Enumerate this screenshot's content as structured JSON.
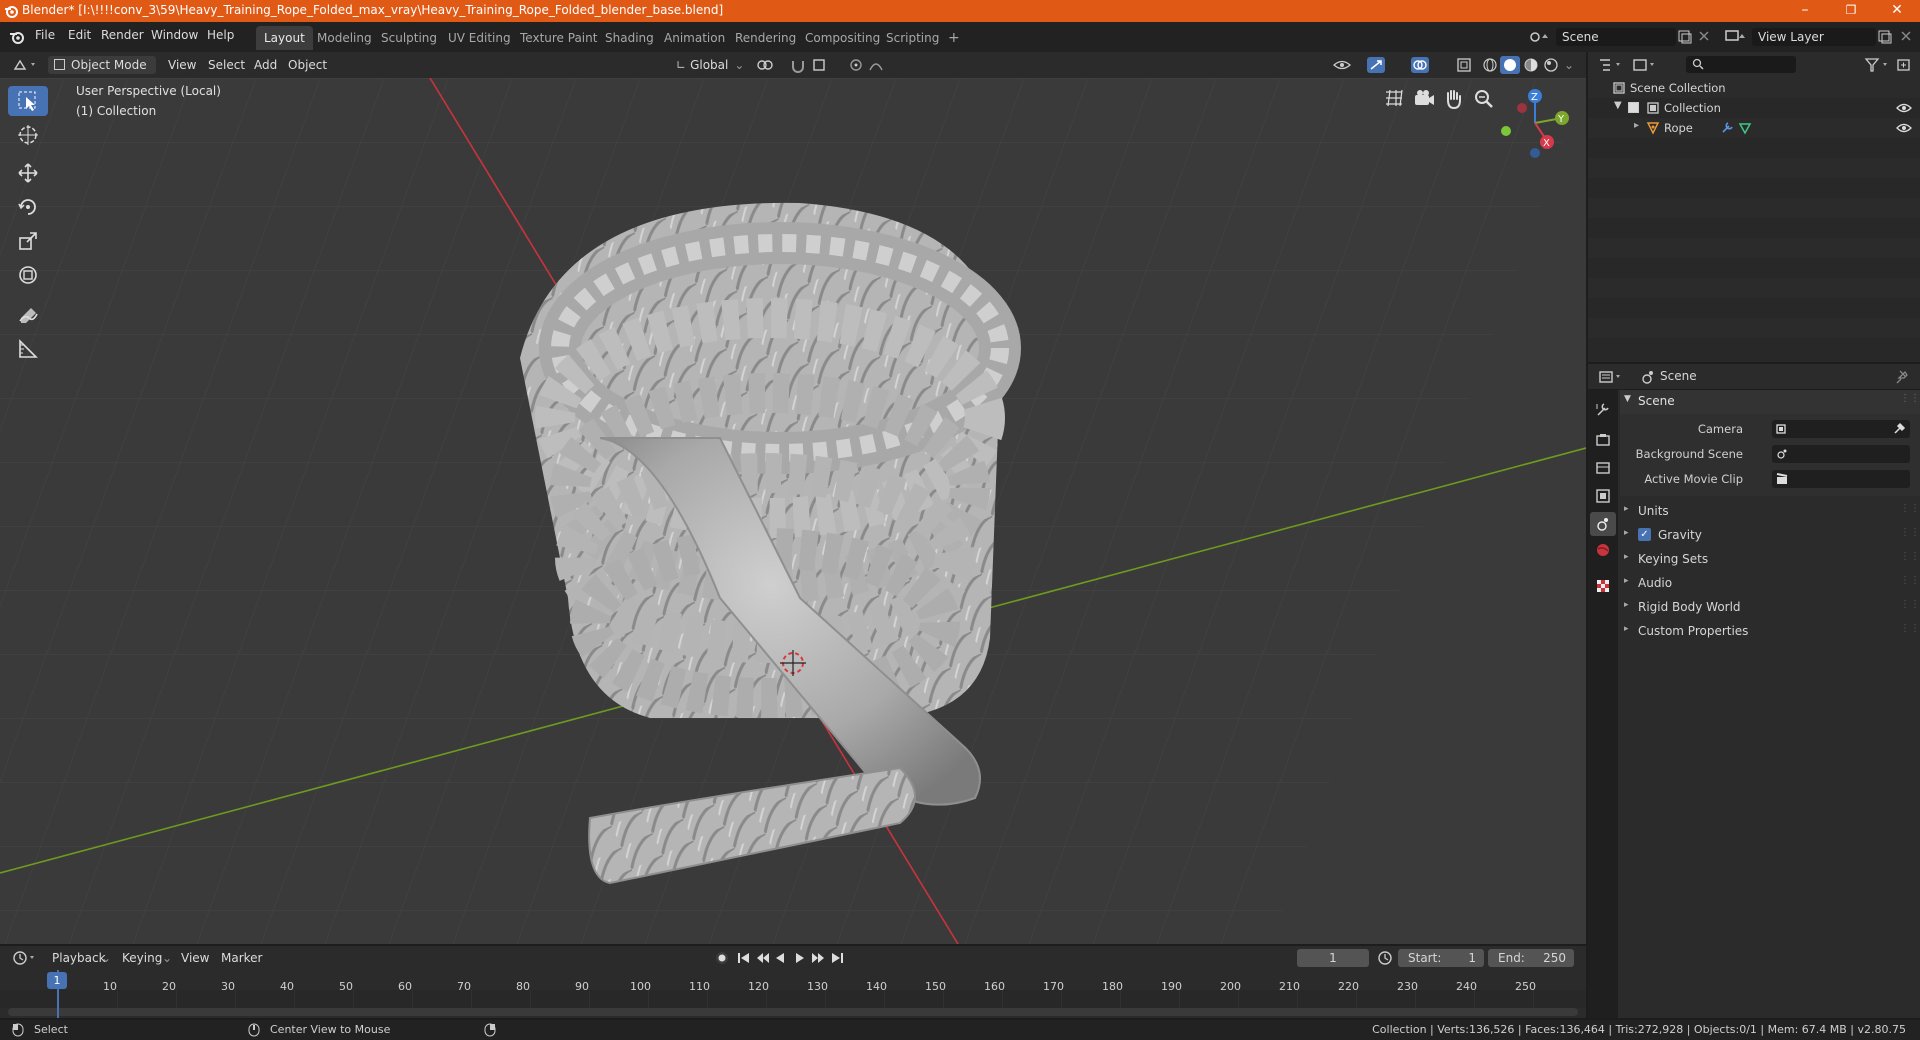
{
  "titlebar": {
    "title": "Blender* [I:\\!!!!conv_3\\59\\Heavy_Training_Rope_Folded_max_vray\\Heavy_Training_Rope_Folded_blender_base.blend]",
    "minimize": "–",
    "restore": "❐",
    "close": "✕"
  },
  "menu": [
    "File",
    "Edit",
    "Render",
    "Window",
    "Help"
  ],
  "workspaces": [
    "Layout",
    "Modeling",
    "Sculpting",
    "UV Editing",
    "Texture Paint",
    "Shading",
    "Animation",
    "Rendering",
    "Compositing",
    "Scripting"
  ],
  "workspace_add": "+",
  "scene_field": "Scene",
  "view_layer_field": "View Layer",
  "viewport_header": {
    "mode": "Object Mode",
    "view": "View",
    "select": "Select",
    "add": "Add",
    "object": "Object",
    "orientation": "Global"
  },
  "viewport": {
    "perspective_label": "User Perspective (Local)",
    "collection_label": "(1) Collection",
    "gizmo_axes": [
      "Z",
      "Y",
      "X"
    ]
  },
  "outliner": {
    "items": [
      {
        "label": "Scene Collection"
      },
      {
        "label": "Collection"
      },
      {
        "label": "Rope"
      }
    ]
  },
  "properties": {
    "header_title": "Scene",
    "panel_title": "Scene",
    "fields": [
      {
        "label": "Camera"
      },
      {
        "label": "Background Scene"
      },
      {
        "label": "Active Movie Clip"
      }
    ],
    "subpanels": [
      "Units",
      "Gravity",
      "Keying Sets",
      "Audio",
      "Rigid Body World",
      "Custom Properties"
    ]
  },
  "timeline": {
    "menus": [
      "Playback",
      "Keying",
      "View",
      "Marker"
    ],
    "current_frame": "1",
    "start_label": "Start:",
    "start_value": "1",
    "end_label": "End:",
    "end_value": "250",
    "ticks": [
      "1",
      "10",
      "20",
      "30",
      "40",
      "50",
      "60",
      "70",
      "80",
      "90",
      "100",
      "110",
      "120",
      "130",
      "140",
      "150",
      "160",
      "170",
      "180",
      "190",
      "200",
      "210",
      "220",
      "230",
      "240",
      "250"
    ]
  },
  "statusbar": {
    "select": "Select",
    "center_view": "Center View to Mouse",
    "stats": "Collection | Verts:136,526 | Faces:136,464 | Tris:272,928 | Objects:0/1 | Mem: 67.4 MB | v2.80.75"
  },
  "colors": {
    "title_bg": "#e05a16",
    "active_blue": "#4772b3",
    "axis_red": "#c8343d",
    "axis_green": "#6e9b1e",
    "rope": "#b9b9b9"
  }
}
